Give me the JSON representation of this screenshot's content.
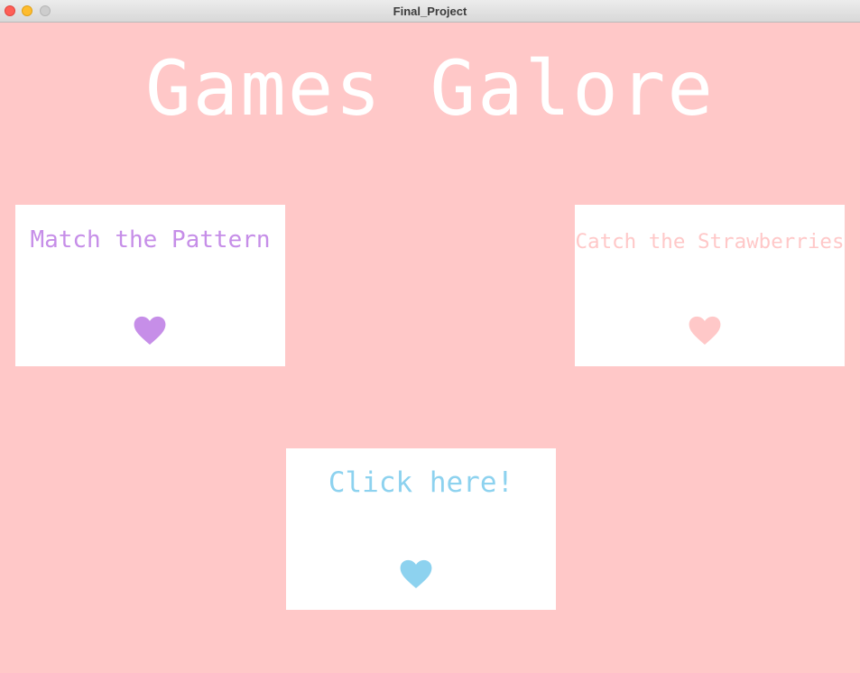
{
  "window": {
    "title": "Final_Project"
  },
  "heading": "Games Galore",
  "cards": [
    {
      "label": "Match the Pattern",
      "color": "#c68ee8",
      "icon": "heart-icon"
    },
    {
      "label": "Catch the Strawberries",
      "color": "#ffc8c8",
      "icon": "heart-icon"
    },
    {
      "label": "Click here!",
      "color": "#8dd2ef",
      "icon": "heart-icon"
    }
  ],
  "colors": {
    "background": "#ffc8c8",
    "card": "#ffffff",
    "heading": "#ffffff"
  }
}
